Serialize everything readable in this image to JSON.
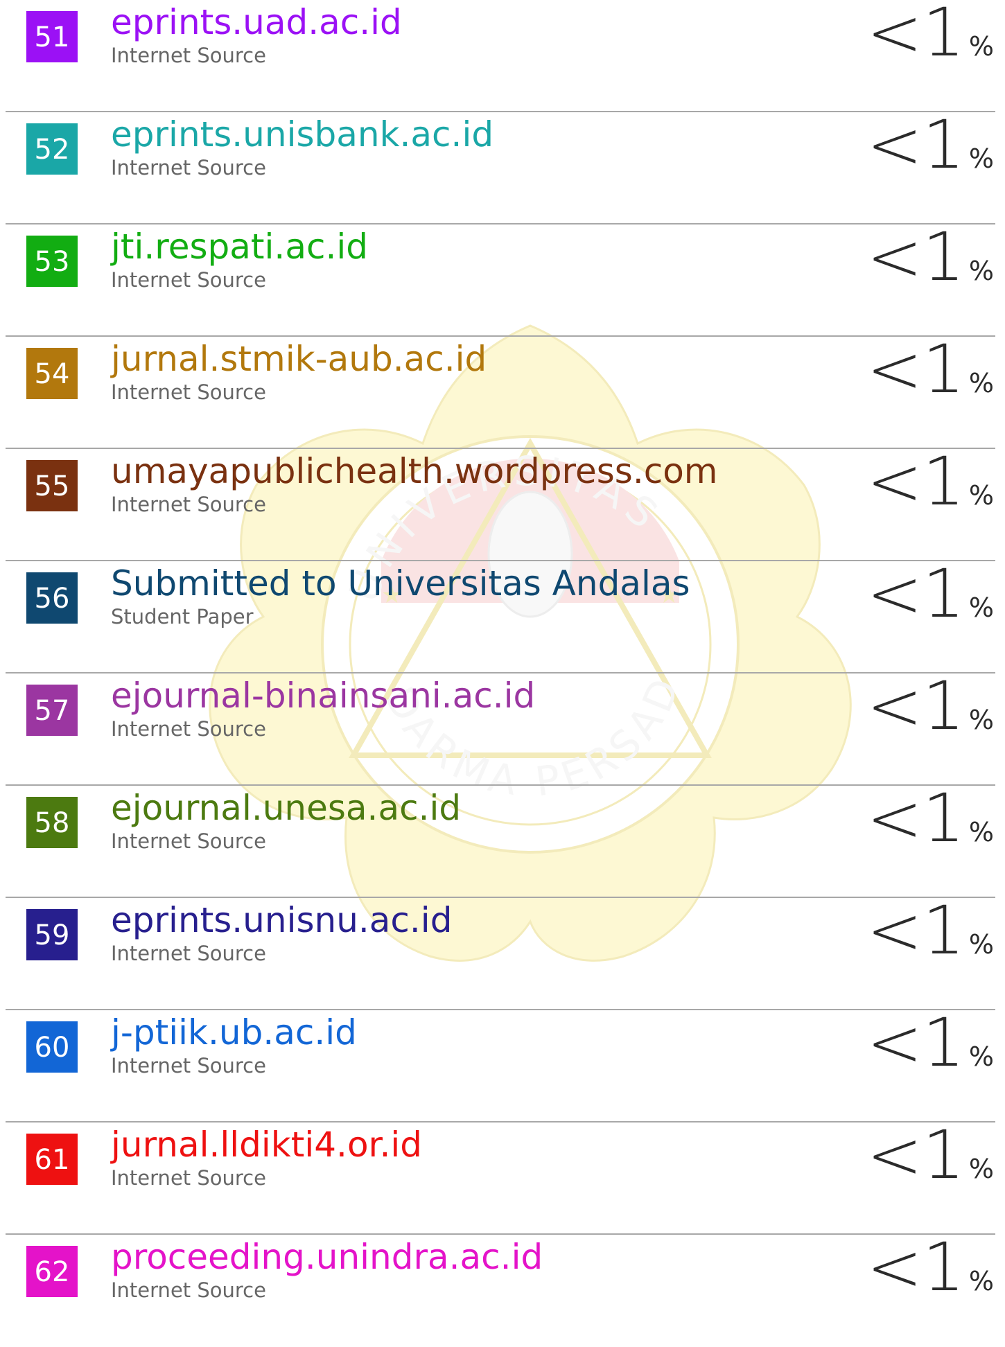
{
  "colors": {
    "divider": "#a8a8a8",
    "source_type_text": "#666666",
    "percent_text": "#2b2b2b",
    "watermark_yellow": "#fdf3a8",
    "watermark_red": "#f7c9c9"
  },
  "watermark": {
    "top_text": "UNIVERSITAS",
    "bottom_text": "DARMA PERSADA"
  },
  "sources": [
    {
      "rank": "51",
      "title": "eprints.uad.ac.id",
      "type": "Internet Source",
      "lt": "<1",
      "pct": "%",
      "color": "#9b11f5"
    },
    {
      "rank": "52",
      "title": "eprints.unisbank.ac.id",
      "type": "Internet Source",
      "lt": "<1",
      "pct": "%",
      "color": "#1aa7a7"
    },
    {
      "rank": "53",
      "title": "jti.respati.ac.id",
      "type": "Internet Source",
      "lt": "<1",
      "pct": "%",
      "color": "#12ad12"
    },
    {
      "rank": "54",
      "title": "jurnal.stmik-aub.ac.id",
      "type": "Internet Source",
      "lt": "<1",
      "pct": "%",
      "color": "#b2780d"
    },
    {
      "rank": "55",
      "title": "umayapublichealth.wordpress.com",
      "type": "Internet Source",
      "lt": "<1",
      "pct": "%",
      "color": "#7a3110"
    },
    {
      "rank": "56",
      "title": "Submitted to Universitas Andalas",
      "type": "Student Paper",
      "lt": "<1",
      "pct": "%",
      "color": "#0f4870"
    },
    {
      "rank": "57",
      "title": "ejournal-binainsani.ac.id",
      "type": "Internet Source",
      "lt": "<1",
      "pct": "%",
      "color": "#9b36a1"
    },
    {
      "rank": "58",
      "title": "ejournal.unesa.ac.id",
      "type": "Internet Source",
      "lt": "<1",
      "pct": "%",
      "color": "#4c7a10"
    },
    {
      "rank": "59",
      "title": "eprints.unisnu.ac.id",
      "type": "Internet Source",
      "lt": "<1",
      "pct": "%",
      "color": "#271f8e"
    },
    {
      "rank": "60",
      "title": "j-ptiik.ub.ac.id",
      "type": "Internet Source",
      "lt": "<1",
      "pct": "%",
      "color": "#1266d6"
    },
    {
      "rank": "61",
      "title": "jurnal.lldikti4.or.id",
      "type": "Internet Source",
      "lt": "<1",
      "pct": "%",
      "color": "#ee1111"
    },
    {
      "rank": "62",
      "title": "proceeding.unindra.ac.id",
      "type": "Internet Source",
      "lt": "<1",
      "pct": "%",
      "color": "#e413c9"
    }
  ]
}
